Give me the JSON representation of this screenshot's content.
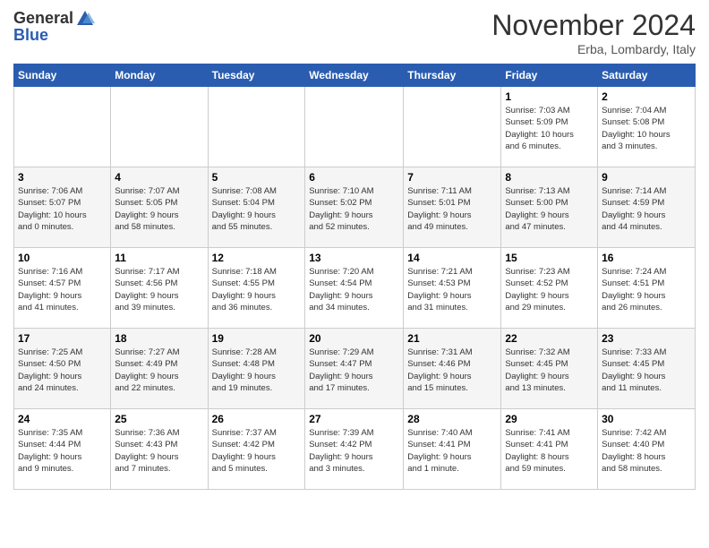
{
  "header": {
    "logo_general": "General",
    "logo_blue": "Blue",
    "month": "November 2024",
    "location": "Erba, Lombardy, Italy"
  },
  "days_of_week": [
    "Sunday",
    "Monday",
    "Tuesday",
    "Wednesday",
    "Thursday",
    "Friday",
    "Saturday"
  ],
  "weeks": [
    [
      {
        "day": "",
        "info": ""
      },
      {
        "day": "",
        "info": ""
      },
      {
        "day": "",
        "info": ""
      },
      {
        "day": "",
        "info": ""
      },
      {
        "day": "",
        "info": ""
      },
      {
        "day": "1",
        "info": "Sunrise: 7:03 AM\nSunset: 5:09 PM\nDaylight: 10 hours\nand 6 minutes."
      },
      {
        "day": "2",
        "info": "Sunrise: 7:04 AM\nSunset: 5:08 PM\nDaylight: 10 hours\nand 3 minutes."
      }
    ],
    [
      {
        "day": "3",
        "info": "Sunrise: 7:06 AM\nSunset: 5:07 PM\nDaylight: 10 hours\nand 0 minutes."
      },
      {
        "day": "4",
        "info": "Sunrise: 7:07 AM\nSunset: 5:05 PM\nDaylight: 9 hours\nand 58 minutes."
      },
      {
        "day": "5",
        "info": "Sunrise: 7:08 AM\nSunset: 5:04 PM\nDaylight: 9 hours\nand 55 minutes."
      },
      {
        "day": "6",
        "info": "Sunrise: 7:10 AM\nSunset: 5:02 PM\nDaylight: 9 hours\nand 52 minutes."
      },
      {
        "day": "7",
        "info": "Sunrise: 7:11 AM\nSunset: 5:01 PM\nDaylight: 9 hours\nand 49 minutes."
      },
      {
        "day": "8",
        "info": "Sunrise: 7:13 AM\nSunset: 5:00 PM\nDaylight: 9 hours\nand 47 minutes."
      },
      {
        "day": "9",
        "info": "Sunrise: 7:14 AM\nSunset: 4:59 PM\nDaylight: 9 hours\nand 44 minutes."
      }
    ],
    [
      {
        "day": "10",
        "info": "Sunrise: 7:16 AM\nSunset: 4:57 PM\nDaylight: 9 hours\nand 41 minutes."
      },
      {
        "day": "11",
        "info": "Sunrise: 7:17 AM\nSunset: 4:56 PM\nDaylight: 9 hours\nand 39 minutes."
      },
      {
        "day": "12",
        "info": "Sunrise: 7:18 AM\nSunset: 4:55 PM\nDaylight: 9 hours\nand 36 minutes."
      },
      {
        "day": "13",
        "info": "Sunrise: 7:20 AM\nSunset: 4:54 PM\nDaylight: 9 hours\nand 34 minutes."
      },
      {
        "day": "14",
        "info": "Sunrise: 7:21 AM\nSunset: 4:53 PM\nDaylight: 9 hours\nand 31 minutes."
      },
      {
        "day": "15",
        "info": "Sunrise: 7:23 AM\nSunset: 4:52 PM\nDaylight: 9 hours\nand 29 minutes."
      },
      {
        "day": "16",
        "info": "Sunrise: 7:24 AM\nSunset: 4:51 PM\nDaylight: 9 hours\nand 26 minutes."
      }
    ],
    [
      {
        "day": "17",
        "info": "Sunrise: 7:25 AM\nSunset: 4:50 PM\nDaylight: 9 hours\nand 24 minutes."
      },
      {
        "day": "18",
        "info": "Sunrise: 7:27 AM\nSunset: 4:49 PM\nDaylight: 9 hours\nand 22 minutes."
      },
      {
        "day": "19",
        "info": "Sunrise: 7:28 AM\nSunset: 4:48 PM\nDaylight: 9 hours\nand 19 minutes."
      },
      {
        "day": "20",
        "info": "Sunrise: 7:29 AM\nSunset: 4:47 PM\nDaylight: 9 hours\nand 17 minutes."
      },
      {
        "day": "21",
        "info": "Sunrise: 7:31 AM\nSunset: 4:46 PM\nDaylight: 9 hours\nand 15 minutes."
      },
      {
        "day": "22",
        "info": "Sunrise: 7:32 AM\nSunset: 4:45 PM\nDaylight: 9 hours\nand 13 minutes."
      },
      {
        "day": "23",
        "info": "Sunrise: 7:33 AM\nSunset: 4:45 PM\nDaylight: 9 hours\nand 11 minutes."
      }
    ],
    [
      {
        "day": "24",
        "info": "Sunrise: 7:35 AM\nSunset: 4:44 PM\nDaylight: 9 hours\nand 9 minutes."
      },
      {
        "day": "25",
        "info": "Sunrise: 7:36 AM\nSunset: 4:43 PM\nDaylight: 9 hours\nand 7 minutes."
      },
      {
        "day": "26",
        "info": "Sunrise: 7:37 AM\nSunset: 4:42 PM\nDaylight: 9 hours\nand 5 minutes."
      },
      {
        "day": "27",
        "info": "Sunrise: 7:39 AM\nSunset: 4:42 PM\nDaylight: 9 hours\nand 3 minutes."
      },
      {
        "day": "28",
        "info": "Sunrise: 7:40 AM\nSunset: 4:41 PM\nDaylight: 9 hours\nand 1 minute."
      },
      {
        "day": "29",
        "info": "Sunrise: 7:41 AM\nSunset: 4:41 PM\nDaylight: 8 hours\nand 59 minutes."
      },
      {
        "day": "30",
        "info": "Sunrise: 7:42 AM\nSunset: 4:40 PM\nDaylight: 8 hours\nand 58 minutes."
      }
    ]
  ]
}
